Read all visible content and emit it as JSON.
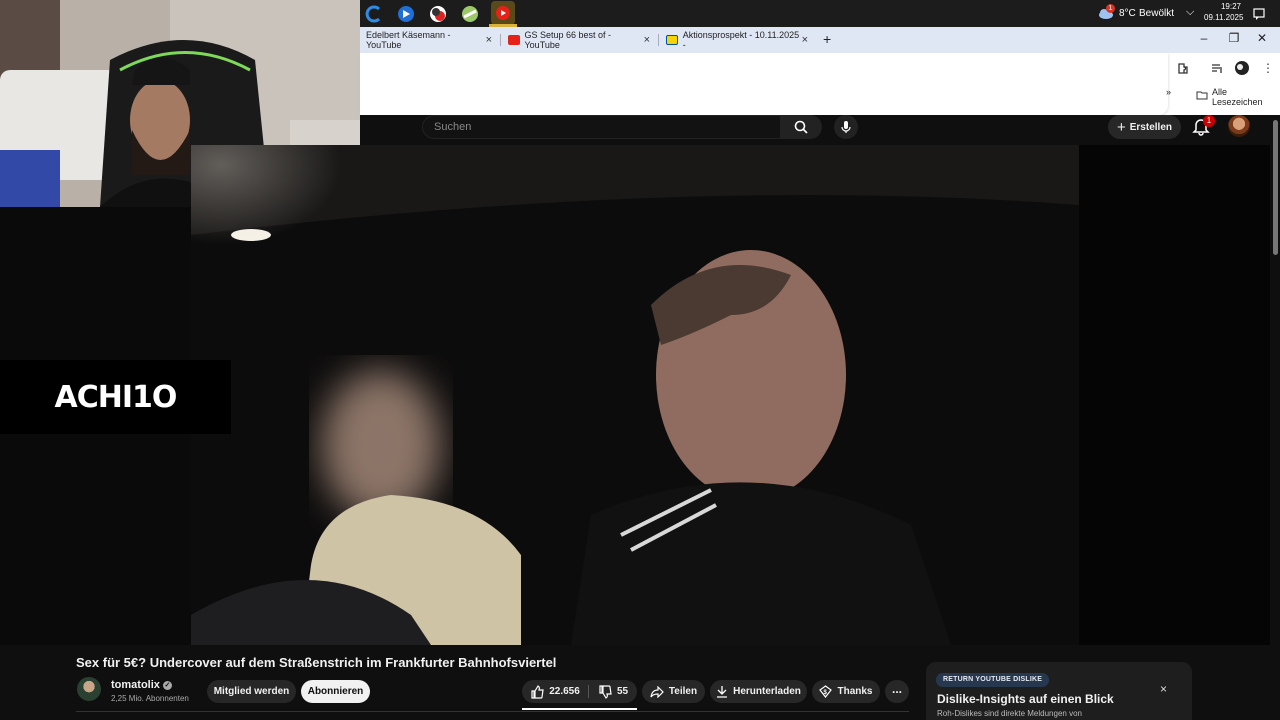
{
  "taskbar": {
    "weather_temp": "8°C",
    "weather_desc": "Bewölkt",
    "weather_badge": "1",
    "time": "19:27",
    "date": "09.11.2025"
  },
  "tabs": [
    {
      "label": "Edelbert Käsemann - YouTube"
    },
    {
      "label": "GS Setup 66 best of - YouTube"
    },
    {
      "label": "Aktionsprospekt - 10.11.2025 -"
    }
  ],
  "bookmarks": {
    "all_label": "Alle Lesezeichen",
    "chevron": "»"
  },
  "youtube": {
    "search_placeholder": "Suchen",
    "create_label": "Erstellen",
    "notifications_count": "1"
  },
  "overlay": {
    "logo": "ACHI1O"
  },
  "video": {
    "title": "Sex für 5€? Undercover auf dem Straßenstrich im Frankfurter Bahnhofsviertel",
    "channel_name": "tomatolix",
    "subscribers": "2,25 Mio. Abonnenten",
    "join_label": "Mitglied werden",
    "subscribe_label": "Abonnieren",
    "likes": "22.656",
    "dislikes": "55",
    "share_label": "Teilen",
    "download_label": "Herunterladen",
    "thanks_label": "Thanks",
    "more_label": "..."
  },
  "dislike_panel": {
    "badge": "RETURN YOUTUBE DISLIKE",
    "title": "Dislike-Insights auf einen Blick",
    "subtitle": "Roh-Dislikes sind direkte Meldungen von",
    "close": "×"
  }
}
